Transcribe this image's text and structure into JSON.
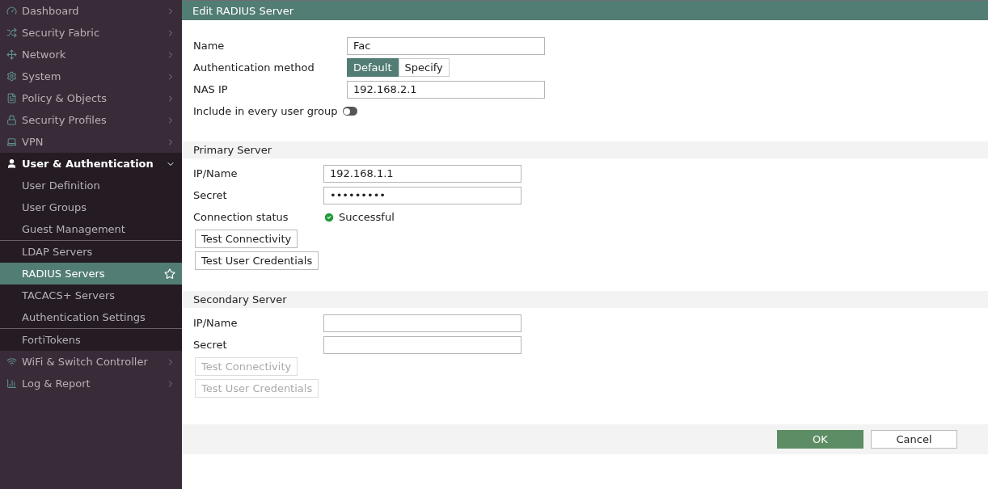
{
  "sidebar": {
    "items": [
      {
        "label": "Dashboard",
        "expanded": false
      },
      {
        "label": "Security Fabric",
        "expanded": false
      },
      {
        "label": "Network",
        "expanded": false
      },
      {
        "label": "System",
        "expanded": false
      },
      {
        "label": "Policy & Objects",
        "expanded": false
      },
      {
        "label": "Security Profiles",
        "expanded": false
      },
      {
        "label": "VPN",
        "expanded": false
      },
      {
        "label": "User & Authentication",
        "expanded": true,
        "child_groups": [
          [
            {
              "label": "User Definition",
              "selected": false
            },
            {
              "label": "User Groups",
              "selected": false
            },
            {
              "label": "Guest Management",
              "selected": false
            }
          ],
          [
            {
              "label": "LDAP Servers",
              "selected": false
            },
            {
              "label": "RADIUS Servers",
              "selected": true
            },
            {
              "label": "TACACS+ Servers",
              "selected": false
            },
            {
              "label": "Authentication Settings",
              "selected": false
            }
          ],
          [
            {
              "label": "FortiTokens",
              "selected": false
            }
          ]
        ]
      },
      {
        "label": "WiFi & Switch Controller",
        "expanded": false
      },
      {
        "label": "Log & Report",
        "expanded": false
      }
    ]
  },
  "panel": {
    "title": "Edit RADIUS Server",
    "general": {
      "name": {
        "label": "Name",
        "value": "Fac"
      },
      "auth_method": {
        "label": "Authentication method",
        "options": [
          {
            "label": "Default",
            "selected": true
          },
          {
            "label": "Specify",
            "selected": false
          }
        ]
      },
      "nas_ip": {
        "label": "NAS IP",
        "value": "192.168.2.1"
      },
      "include_all": {
        "label": "Include in every user group",
        "on": false
      }
    },
    "servers": [
      {
        "title": "Primary Server",
        "ip": {
          "label": "IP/Name",
          "value": "192.168.1.1"
        },
        "secret": {
          "label": "Secret",
          "value": "•••••••••"
        },
        "status": {
          "label": "Connection status",
          "kind": "success",
          "text": "Successful"
        },
        "buttons": [
          {
            "label": "Test Connectivity",
            "disabled": false
          },
          {
            "label": "Test User Credentials",
            "disabled": false
          }
        ]
      },
      {
        "title": "Secondary Server",
        "ip": {
          "label": "IP/Name"
        },
        "secret": {
          "label": "Secret"
        },
        "buttons": [
          {
            "label": "Test Connectivity",
            "disabled": true
          },
          {
            "label": "Test User Credentials",
            "disabled": true
          }
        ]
      }
    ],
    "footer": {
      "buttons": [
        {
          "label": "OK",
          "kind": "primary"
        },
        {
          "label": "Cancel",
          "kind": "secondary"
        }
      ]
    }
  }
}
